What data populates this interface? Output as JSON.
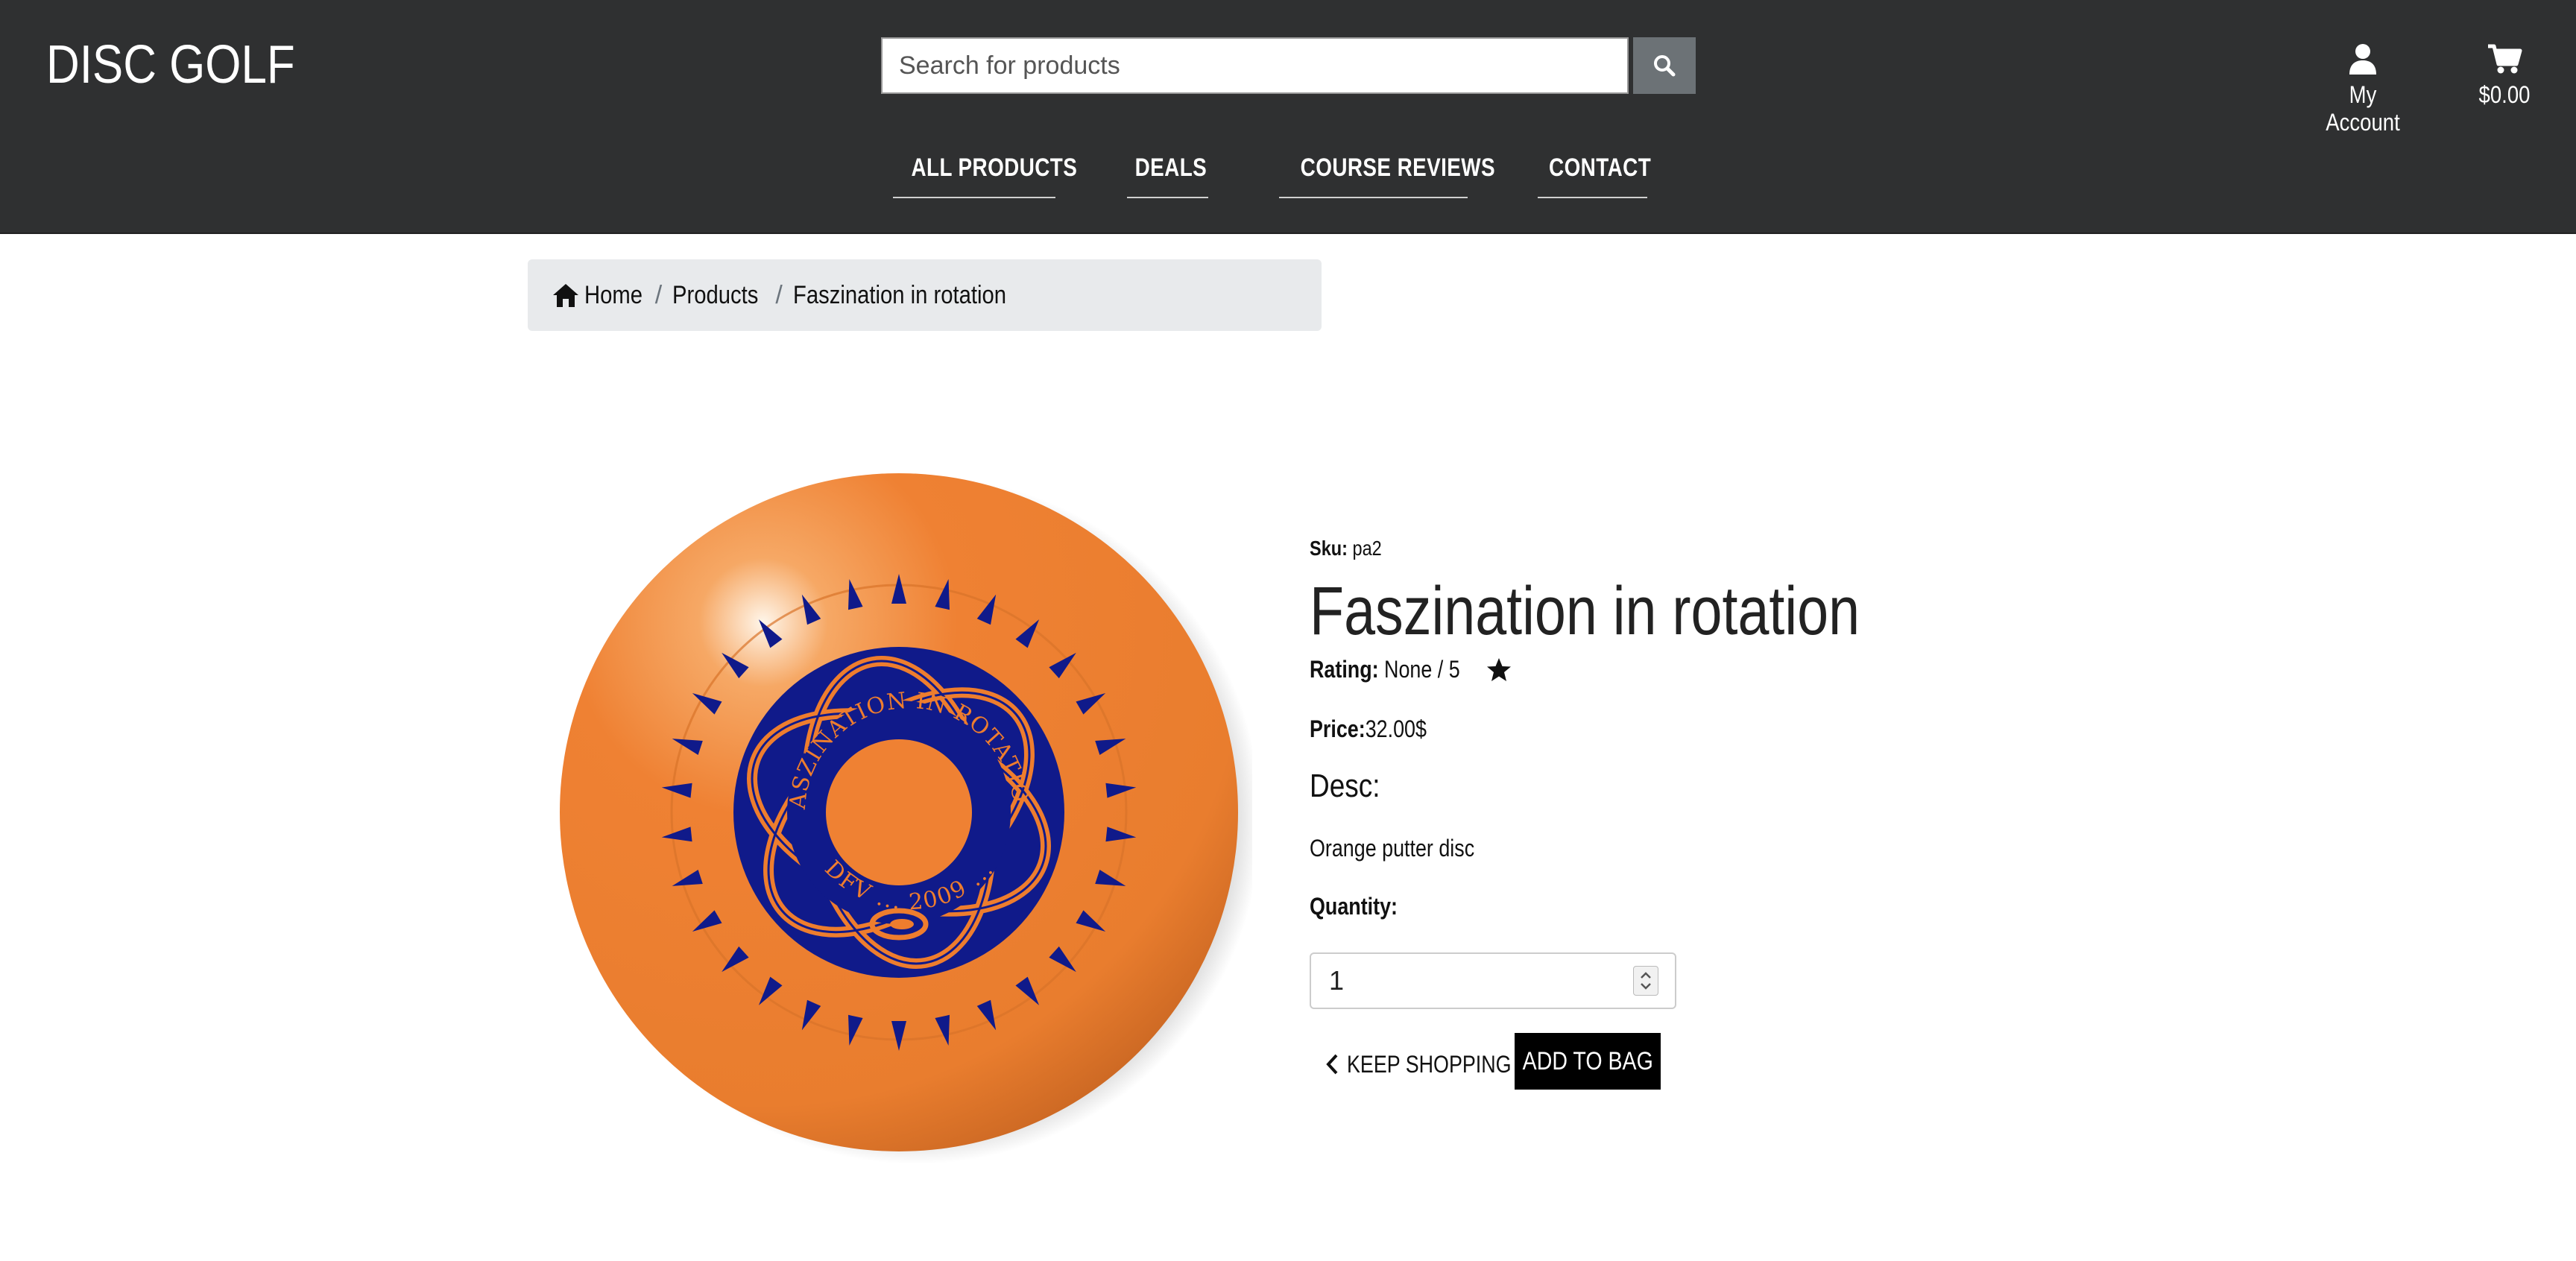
{
  "header": {
    "brand": "DISC GOLF",
    "search_placeholder": "Search for products",
    "account_label": "My Account",
    "cart_total": "$0.00",
    "icons": {
      "search": "search-icon",
      "account": "user-icon",
      "cart": "cart-icon"
    }
  },
  "nav": {
    "items": [
      {
        "label": "ALL PRODUCTS"
      },
      {
        "label": "DEALS"
      },
      {
        "label": "COURSE REVIEWS"
      },
      {
        "label": "CONTACT"
      }
    ]
  },
  "breadcrumb": {
    "items": [
      {
        "label": "Home"
      },
      {
        "label": "Products"
      },
      {
        "label": "Faszination in rotation"
      }
    ],
    "separator": "/"
  },
  "product": {
    "sku_label": "Sku:",
    "sku": "pa2",
    "title": "Faszination in rotation",
    "rating_label": "Rating:",
    "rating_value": "None / 5",
    "price_label": "Price:",
    "price": "32.00$",
    "desc_heading": "Desc:",
    "description": "Orange putter disc",
    "quantity_label": "Quantity:",
    "quantity": "1",
    "keep_shopping": "KEEP SHOPPING",
    "add_to_bag": "ADD TO BAG",
    "disc_text_top": "FASZINATION IN ROTATION",
    "disc_text_bottom": "DFV ... 2009 ...",
    "colors": {
      "disc": "#ee7d2e",
      "stamp": "#101a8a",
      "header": "#2f3031"
    }
  }
}
